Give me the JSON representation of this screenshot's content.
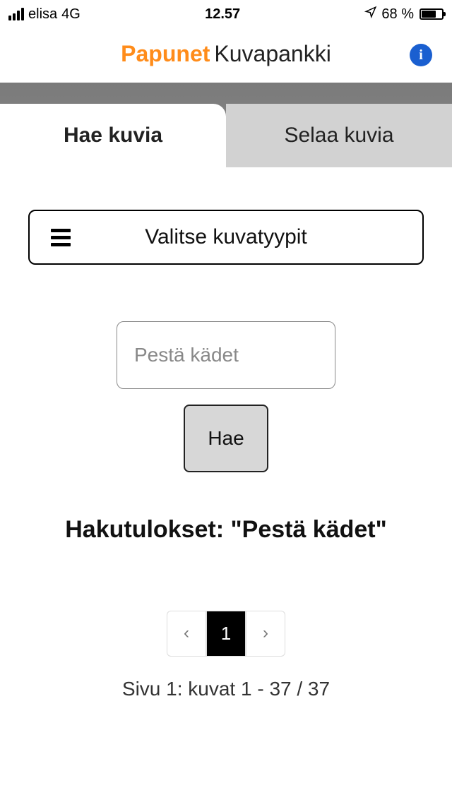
{
  "status": {
    "carrier": "elisa",
    "network": "4G",
    "time": "12.57",
    "battery_percent": "68 %"
  },
  "header": {
    "brand": "Papunet",
    "title": "Kuvapankki"
  },
  "tabs": {
    "active": "Hae kuvia",
    "inactive": "Selaa kuvia"
  },
  "type_selector": {
    "label": "Valitse kuvatyypit"
  },
  "search": {
    "value": "Pestä kädet",
    "button": "Hae"
  },
  "results": {
    "heading": "Hakutulokset: \"Pestä kädet\""
  },
  "pagination": {
    "prev": "‹",
    "current": "1",
    "next": "›",
    "summary": "Sivu 1: kuvat 1 - 37 / 37"
  }
}
